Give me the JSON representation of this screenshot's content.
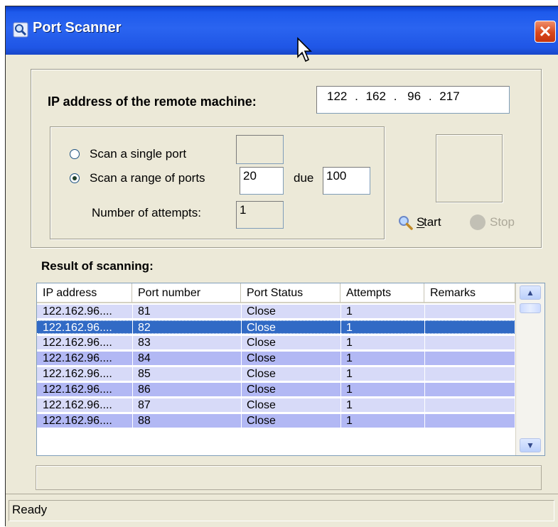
{
  "window": {
    "title": "Port Scanner",
    "close_glyph": "✕"
  },
  "ip": {
    "label": "IP address of the remote machine:",
    "octets": [
      "122",
      "162",
      "96",
      "217"
    ],
    "separator": "."
  },
  "scan_options": {
    "single_port_label": "Scan a single port",
    "single_port_value": "",
    "range_label": "Scan a range of ports",
    "range_from": "20",
    "range_to_label": "due",
    "range_to": "100",
    "attempts_label": "Number of attempts:",
    "attempts_value": "1",
    "selected_mode": "range"
  },
  "actions": {
    "start_label": "Start",
    "start_mnemonic": "S",
    "stop_label": "Stop",
    "stop_mnemonic": "o",
    "start_icon": "magnifier-icon",
    "stop_icon": "circle-icon"
  },
  "results": {
    "heading": "Result of scanning:",
    "columns": [
      "IP address",
      "Port number",
      "Port Status",
      "Attempts",
      "Remarks"
    ],
    "rows": [
      {
        "ip": "122.162.96....",
        "port": "81",
        "status": "Close",
        "attempts": "1",
        "remarks": ""
      },
      {
        "ip": "122.162.96....",
        "port": "82",
        "status": "Close",
        "attempts": "1",
        "remarks": ""
      },
      {
        "ip": "122.162.96....",
        "port": "83",
        "status": "Close",
        "attempts": "1",
        "remarks": ""
      },
      {
        "ip": "122.162.96....",
        "port": "84",
        "status": "Close",
        "attempts": "1",
        "remarks": ""
      },
      {
        "ip": "122.162.96....",
        "port": "85",
        "status": "Close",
        "attempts": "1",
        "remarks": ""
      },
      {
        "ip": "122.162.96....",
        "port": "86",
        "status": "Close",
        "attempts": "1",
        "remarks": ""
      },
      {
        "ip": "122.162.96....",
        "port": "87",
        "status": "Close",
        "attempts": "1",
        "remarks": ""
      },
      {
        "ip": "122.162.96....",
        "port": "88",
        "status": "Close",
        "attempts": "1",
        "remarks": ""
      }
    ],
    "selected_port": "82"
  },
  "progress": {
    "text": ""
  },
  "status": {
    "text": "Ready"
  },
  "colors": {
    "title_bar": "#2a64f0",
    "row_light": "#d7daf8",
    "row_dark": "#b2b8f4",
    "row_selected": "#316ac5",
    "window_bg": "#ece9d8"
  }
}
